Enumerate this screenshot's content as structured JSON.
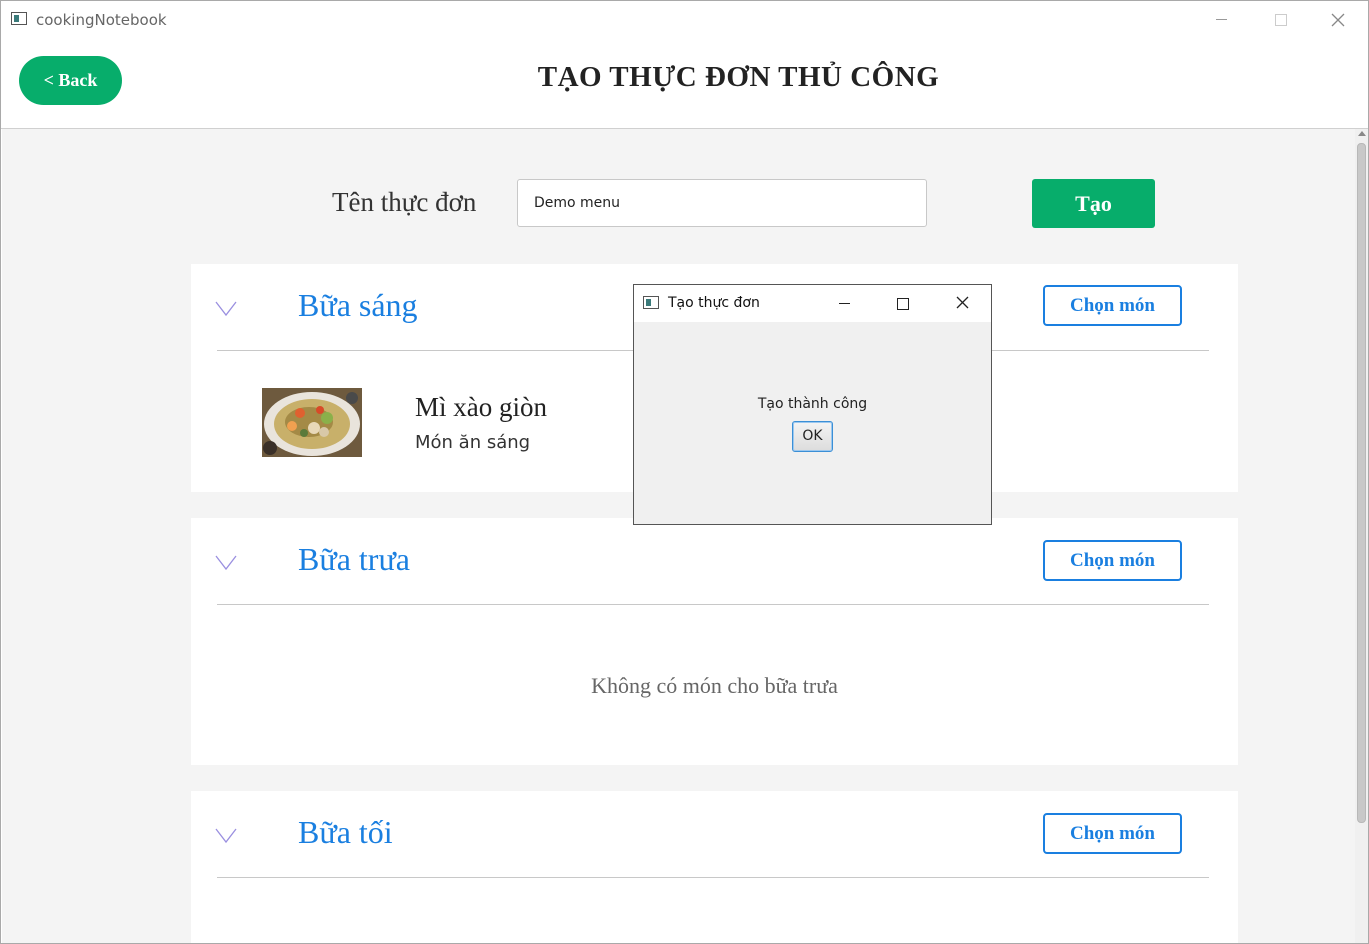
{
  "window": {
    "title": "cookingNotebook",
    "minimize_icon": "minimize-icon",
    "maximize_icon": "maximize-icon",
    "close_icon": "close-icon"
  },
  "header": {
    "back_label": "< Back",
    "title": "TẠO THỰC ĐƠN THỦ CÔNG"
  },
  "form": {
    "name_label": "Tên thực đơn",
    "name_value": "Demo menu",
    "create_label": "Tạo"
  },
  "meals": [
    {
      "title": "Bữa sáng",
      "choose_label": "Chọn món",
      "dishes": [
        {
          "name": "Mì xào giòn",
          "category": "Món ăn sáng"
        }
      ]
    },
    {
      "title": "Bữa trưa",
      "choose_label": "Chọn món",
      "empty_message": "Không có món cho bữa trưa"
    },
    {
      "title": "Bữa tối",
      "choose_label": "Chọn món"
    }
  ],
  "dialog": {
    "title": "Tạo thực đơn",
    "message": "Tạo thành công",
    "ok_label": "OK"
  },
  "colors": {
    "green": "#07ad6b",
    "blue": "#1a7fe0",
    "background": "#f4f4f4"
  }
}
